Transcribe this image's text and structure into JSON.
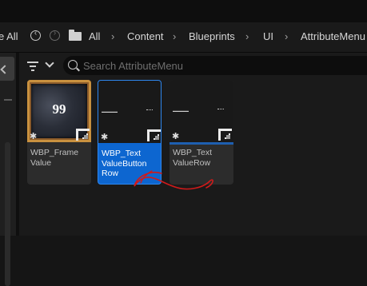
{
  "breadcrumb": {
    "cut_prefix": "e All",
    "items": [
      "All",
      "Content",
      "Blueprints",
      "UI",
      "AttributeMenu"
    ]
  },
  "search": {
    "placeholder": "Search AttributeMenu",
    "value": ""
  },
  "assets": [
    {
      "label": "WBP_Frame Value",
      "selected": false,
      "thumb_number": "99"
    },
    {
      "label": "WBP_Text ValueButton Row",
      "selected": true
    },
    {
      "label": "WBP_Text ValueRow",
      "selected": false
    }
  ],
  "icons": [
    "back-icon",
    "forward-icon",
    "folder-icon",
    "filter-icon",
    "search-icon",
    "blueprint-type-icon",
    "star-icon"
  ],
  "colors": {
    "selected": "#0d66d0",
    "annotation": "#d01a1a",
    "frame": "#c9913f"
  }
}
